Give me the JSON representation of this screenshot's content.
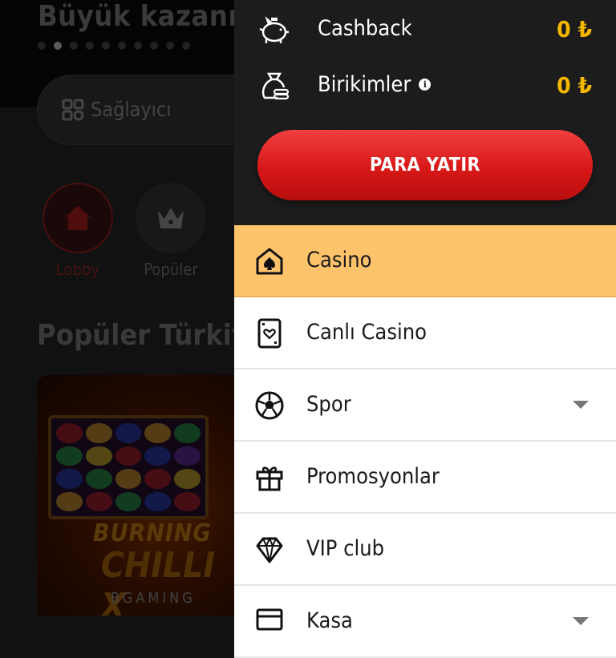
{
  "background": {
    "banner_title": "Büyük kazanın!",
    "provider_label": "Sağlayıcı",
    "categories": [
      {
        "label": "Lobby",
        "icon": "home-icon"
      },
      {
        "label": "Popüler",
        "icon": "crown-icon"
      }
    ],
    "section_title": "Popüler Türkiye",
    "game": {
      "title_line1": "BURNING",
      "title_line2": "CHILLI X",
      "brand": "BGAMING"
    }
  },
  "wallet": {
    "rows": [
      {
        "label": "Cashback",
        "amount": "0 ₺",
        "icon": "piggy-bank-icon"
      },
      {
        "label": "Birikimler",
        "amount": "0 ₺",
        "icon": "money-bag-icon",
        "info_icon": "info-icon"
      }
    ],
    "deposit_label": "PARA YATIR"
  },
  "menu": {
    "items": [
      {
        "label": "Casino",
        "icon": "casino-icon",
        "active": true
      },
      {
        "label": "Canlı Casino",
        "icon": "playing-card-icon"
      },
      {
        "label": "Spor",
        "icon": "soccer-ball-icon",
        "expandable": true
      },
      {
        "label": "Promosyonlar",
        "icon": "gift-icon"
      },
      {
        "label": "VIP club",
        "icon": "diamond-icon"
      },
      {
        "label": "Kasa",
        "icon": "cashier-icon",
        "expandable": true
      }
    ]
  },
  "colors": {
    "accent": "#ffc36b",
    "deposit": "#e02020",
    "amount": "#f5b700",
    "panel_dark": "#1c1c1c"
  }
}
